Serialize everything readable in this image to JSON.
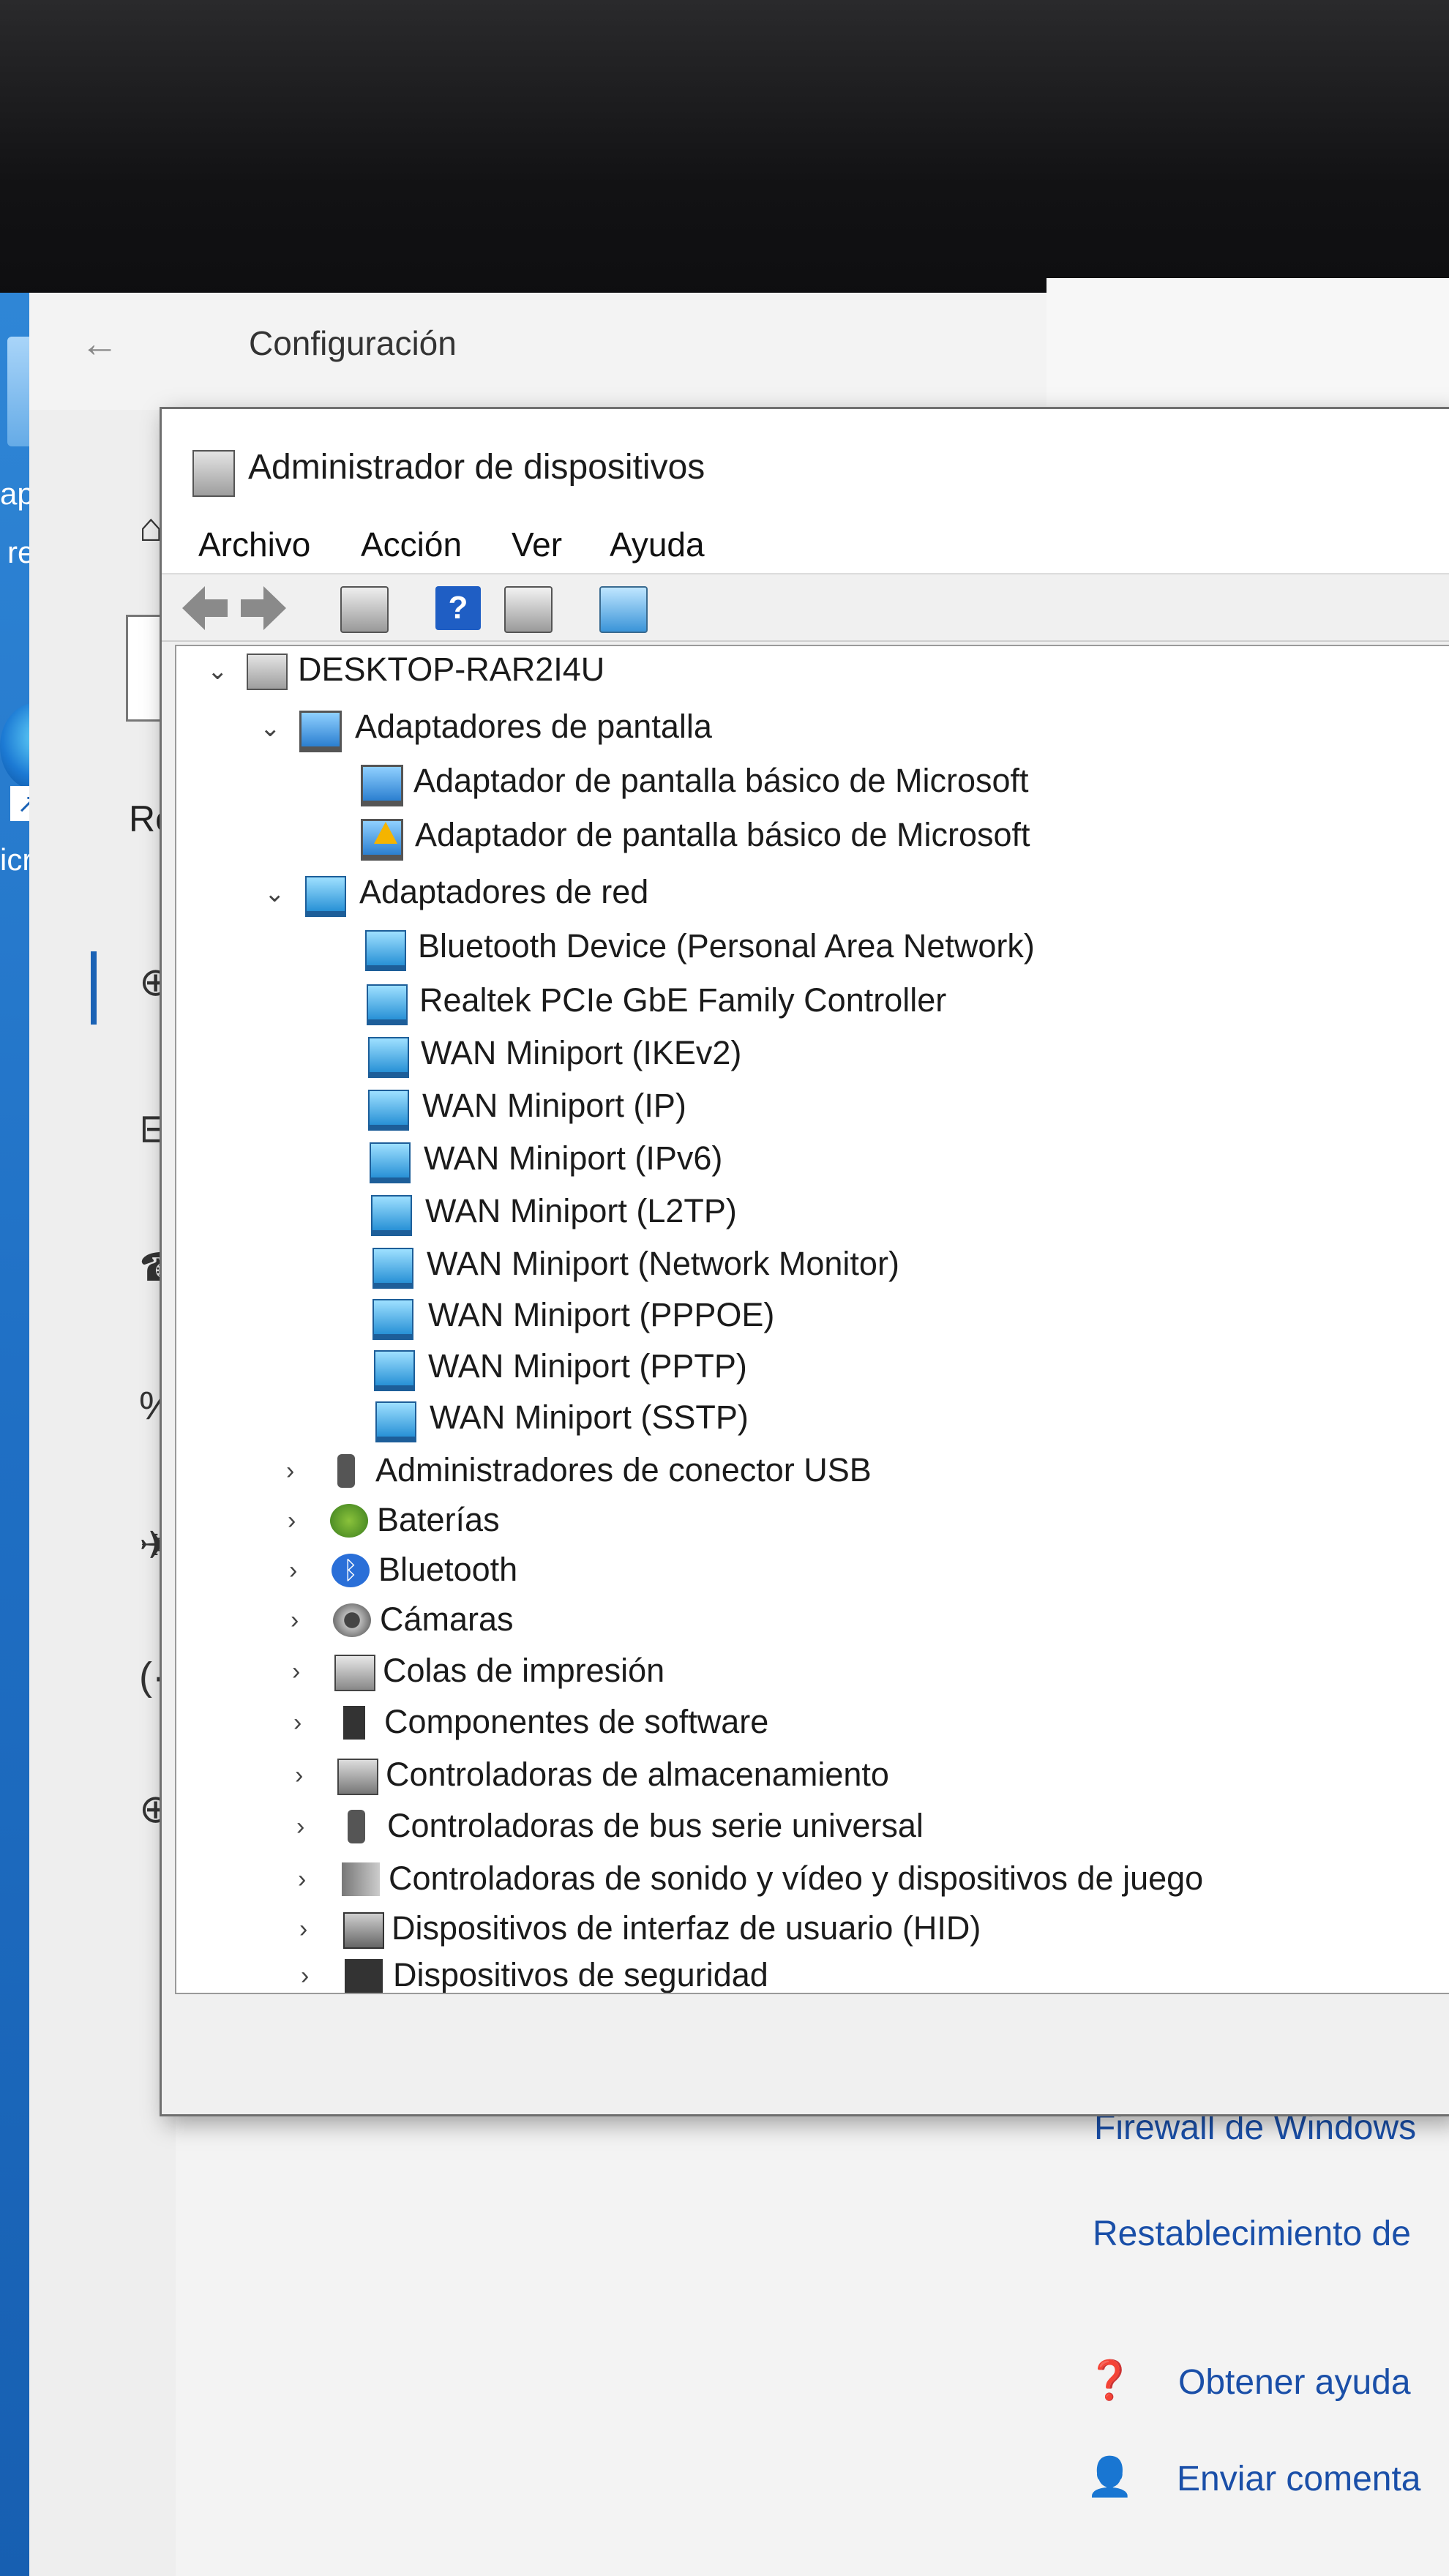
{
  "settings": {
    "title": "Configuración",
    "back_glyph": "←",
    "nav_partial_label": "Re",
    "links": {
      "firewall": "Firewall de Windows",
      "reset": "Restablecimiento de"
    },
    "help": {
      "label": "Obtener ayuda",
      "icon": "help-chat-icon"
    },
    "feedback": {
      "label": "Enviar comenta",
      "icon": "feedback-icon"
    },
    "accent_color": "#1a62b5"
  },
  "desktop": {
    "recycle_label_line1": "apel",
    "recycle_label_line2": "reci",
    "edge_label": "icroso"
  },
  "device_manager": {
    "title": "Administrador de dispositivos",
    "menu": [
      "Archivo",
      "Acción",
      "Ver",
      "Ayuda"
    ],
    "toolbar": [
      "back-arrow-icon",
      "forward-arrow-icon",
      "properties-icon",
      "help-icon",
      "update-driver-icon",
      "scan-hardware-icon"
    ],
    "tree": {
      "root": "DESKTOP-RAR2I4U",
      "display_adapters": {
        "label": "Adaptadores de pantalla",
        "children": [
          "Adaptador de pantalla básico de Microsoft",
          "Adaptador de pantalla básico de Microsoft"
        ]
      },
      "network_adapters": {
        "label": "Adaptadores de red",
        "children": [
          "Bluetooth Device (Personal Area Network)",
          "Realtek PCIe GbE Family Controller",
          "WAN Miniport (IKEv2)",
          "WAN Miniport (IP)",
          "WAN Miniport (IPv6)",
          "WAN Miniport (L2TP)",
          "WAN Miniport (Network Monitor)",
          "WAN Miniport (PPPOE)",
          "WAN Miniport (PPTP)",
          "WAN Miniport (SSTP)"
        ]
      },
      "categories": [
        "Administradores de conector USB",
        "Baterías",
        "Bluetooth",
        "Cámaras",
        "Colas de impresión",
        "Componentes de software",
        "Controladoras de almacenamiento",
        "Controladoras de bus serie universal",
        "Controladoras de sonido y vídeo y dispositivos de juego",
        "Dispositivos de interfaz de usuario (HID)",
        "Dispositivos de seguridad"
      ]
    }
  }
}
